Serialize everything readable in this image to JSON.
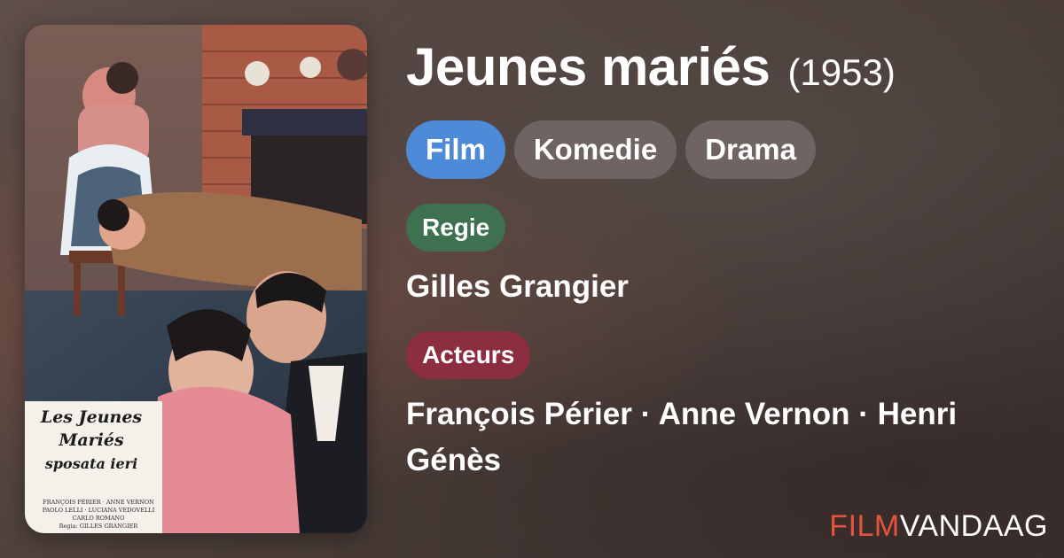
{
  "film": {
    "title": "Jeunes mariés",
    "year": "(1953)"
  },
  "genres": [
    "Film",
    "Komedie",
    "Drama"
  ],
  "director": {
    "label": "Regie",
    "names": "Gilles Grangier"
  },
  "cast": {
    "label": "Acteurs",
    "names": "François Périer · Anne Vernon · Henri Génès"
  },
  "poster": {
    "title_line1": "Les Jeunes Mariés",
    "title_line2": "sposata ieri",
    "credits": [
      "FRANÇOIS PÉRIER · ANNE VERNON",
      "PAOLO LELLI · LUCIANA VEDOVELLI",
      "CARLO ROMANO",
      "Regia: GILLES GRANGIER"
    ]
  },
  "brand": {
    "part1": "FILM",
    "part2": "VANDAAG"
  },
  "colors": {
    "chip_primary": "#4d8ad8",
    "regie_badge": "#3e7150",
    "acteurs_badge": "#8d2e40",
    "brand_accent": "#e5533d"
  }
}
